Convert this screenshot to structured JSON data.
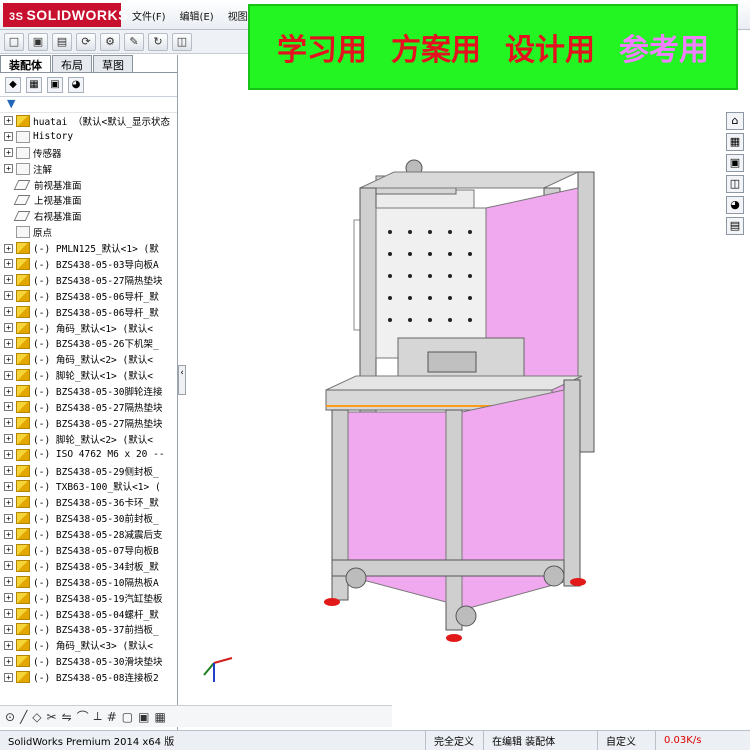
{
  "app": {
    "logo_text": "SOLIDWORKS",
    "logo_mark": "3S",
    "menu": [
      "文件(F)",
      "编辑(E)",
      "视图"
    ]
  },
  "banner": {
    "items": [
      "学习用",
      "方案用",
      "设计用",
      "参考用"
    ]
  },
  "panel": {
    "tabs": [
      "装配体",
      "布局",
      "草图"
    ],
    "filter_symbol": "▼"
  },
  "tree": {
    "root": "huatai （默认<默认_显示状态",
    "fixed": [
      "History",
      "传感器",
      "注解",
      "前视基准面",
      "上视基准面",
      "右视基准面",
      "原点"
    ],
    "components": [
      "(-) PMLN125_默认<1> (默",
      "(-) BZS438-05-03导向板A",
      "(-) BZS438-05-27隔热垫块",
      "(-) BZS438-05-06导杆_默",
      "(-) BZS438-05-06导杆_默",
      "(-) 角码_默认<1> (默认<",
      "(-) BZS438-05-26下机架_",
      "(-) 角码_默认<2> (默认<",
      "(-) 脚轮_默认<1> (默认<",
      "(-) BZS438-05-30脚轮连接",
      "(-) BZS438-05-27隔热垫块",
      "(-) BZS438-05-27隔热垫块",
      "(-) 脚轮_默认<2> (默认<",
      "(-) ISO 4762 M6 x 20 --",
      "(-) BZS438-05-29侧封板_",
      "(-) TXB63-100_默认<1> (",
      "(-) BZS438-05-36卡环_默",
      "(-) BZS438-05-30前封板_",
      "(-) BZS438-05-28减震后支",
      "(-) BZS438-05-07导向板B",
      "(-) BZS438-05-34封板_默",
      "(-) BZS438-05-10隔热板A",
      "(-) BZS438-05-19汽缸垫板",
      "(-) BZS438-05-04螺杆_默",
      "(-) BZS438-05-37前挡板_",
      "(-) 角码_默认<3> (默认<",
      "(-) BZS438-05-30滑块垫块",
      "(-) BZS438-05-08连接板2"
    ]
  },
  "status": {
    "product": "SolidWorks Premium 2014 x64 版",
    "define": "完全定义",
    "mode": "在编辑 装配体",
    "custom": "自定义",
    "network": "0.03K/s"
  },
  "colors": {
    "banner_bg": "#22f522",
    "banner_red": "#e3121e",
    "banner_pink": "#f080ff",
    "panel_pink": "#f0a8ef",
    "frame": "#c9c9c9"
  }
}
